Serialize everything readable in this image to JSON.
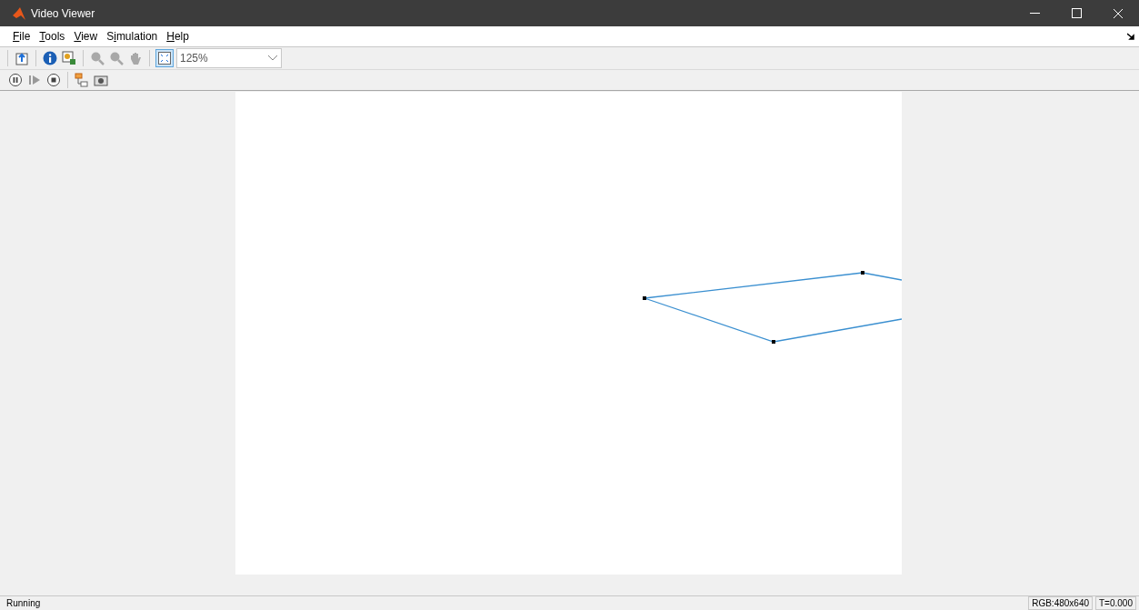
{
  "window": {
    "title": "Video Viewer"
  },
  "menu": [
    {
      "key": "F",
      "after": "ile"
    },
    {
      "key": "T",
      "after": "ools"
    },
    {
      "key": "V",
      "after": "iew"
    },
    {
      "before": "S",
      "key": "i",
      "after": "mulation"
    },
    {
      "key": "H",
      "after": "elp"
    }
  ],
  "toolbar": {
    "zoom": {
      "value": "125%"
    },
    "fit_to_view": {
      "selected": true
    }
  },
  "status_bar": {
    "status": "Running",
    "format": "RGB:480x640",
    "time": "T=0.000"
  }
}
